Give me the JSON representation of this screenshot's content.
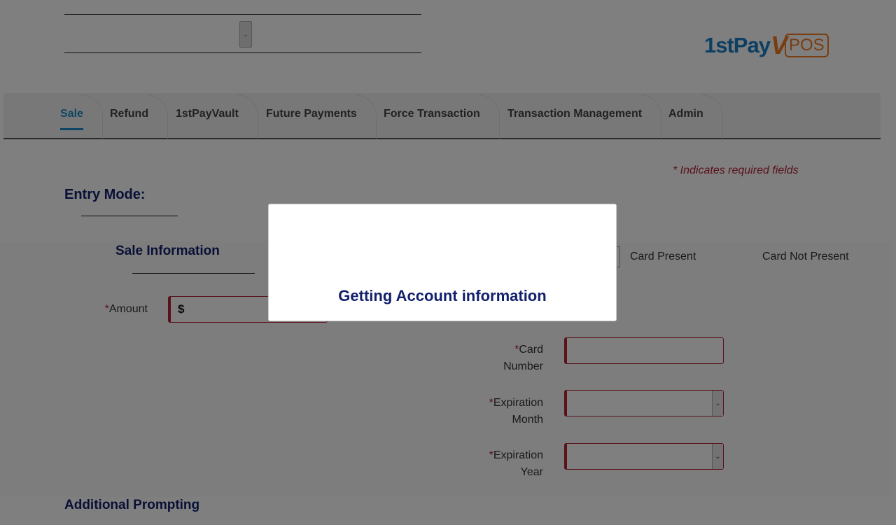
{
  "header": {
    "merchant_select_caret": "⌄",
    "logo": {
      "part1": "1stPay",
      "part2": "V",
      "part3": "POS"
    }
  },
  "nav": {
    "tabs": [
      {
        "label": "Sale"
      },
      {
        "label": "Refund"
      },
      {
        "label": "1stPayVault"
      },
      {
        "label": "Future Payments"
      },
      {
        "label": "Force Transaction"
      },
      {
        "label": "Transaction Management"
      },
      {
        "label": "Admin"
      }
    ],
    "active_tab": "Sale"
  },
  "form": {
    "required_note": "* Indicates required fields",
    "entry_mode": "Entry Mode:",
    "sale_information": "Sale Information",
    "amount_label": "Amount",
    "amount_prefix": "$",
    "card_present": "Card Present",
    "card_not_present": "Card Not Present",
    "card_number_label": {
      "line1": "Card",
      "line2": "Number"
    },
    "exp_month_label": {
      "line1": "Expiration",
      "line2": "Month"
    },
    "exp_year_label": {
      "line1": "Expiration",
      "line2": "Year"
    },
    "required_marker": "*",
    "additional_prompting": "Additional Prompting"
  },
  "modal": {
    "message": "Getting Account information"
  },
  "colors": {
    "navy": "#13206b",
    "accent": "#1b8bc8",
    "required": "#b22234",
    "logo_blue": "#1b7fc4",
    "logo_orange": "#f47a20"
  }
}
